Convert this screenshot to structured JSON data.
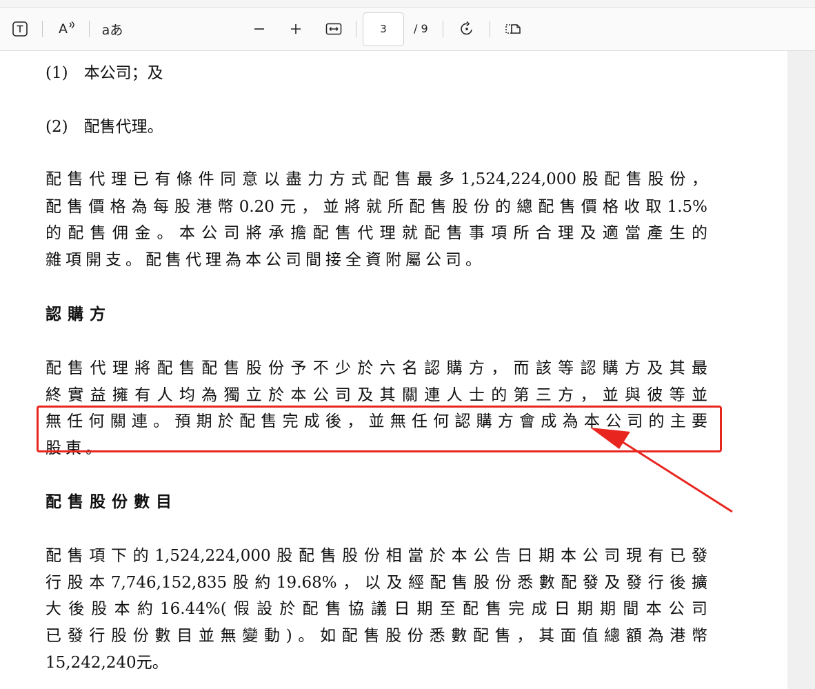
{
  "toolbar": {
    "page_current": "3",
    "page_total": "/ 9",
    "read_aloud_label": "A",
    "translate_label": "aあ"
  },
  "document": {
    "item1": "(1)　本公司；及",
    "item2": "(2)　配售代理。",
    "para1": [
      "配售代理已有條件同意以盡力方式配售最多1,524,224,000股配售股份，",
      "配售價格為每股港幣0.20元，並將就所配售股份的總配售價格收取1.5%",
      "的配售佣金。本公司將承擔配售代理就配售事項所合理及適當產生的",
      "雜項開支。配售代理為本公司間接全資附屬公司。"
    ],
    "heading1": "認購方",
    "para2": [
      "配售代理將配售配售股份予不少於六名認購方，而該等認購方及其最",
      "終實益擁有人均為獨立於本公司及其關連人士的第三方，並與彼等並",
      "無任何關連。預期於配售完成後，並無任何認購方會成為本公司的主要",
      "股東。"
    ],
    "heading2": "配售股份數目",
    "para3": [
      "配售項下的1,524,224,000股配售股份相當於本公告日期本公司現有已發",
      "行股本7,746,152,835股約19.68%，以及經配售股份悉數配發及發行後擴",
      "大後股本約16.44%(假設於配售協議日期至配售完成日期期間本公司",
      "已發行股份數目並無變動)。如配售股份悉數配售，其面值總額為港幣",
      "15,242,240元。"
    ]
  },
  "annotation_colors": {
    "highlight": "#e8261f"
  }
}
